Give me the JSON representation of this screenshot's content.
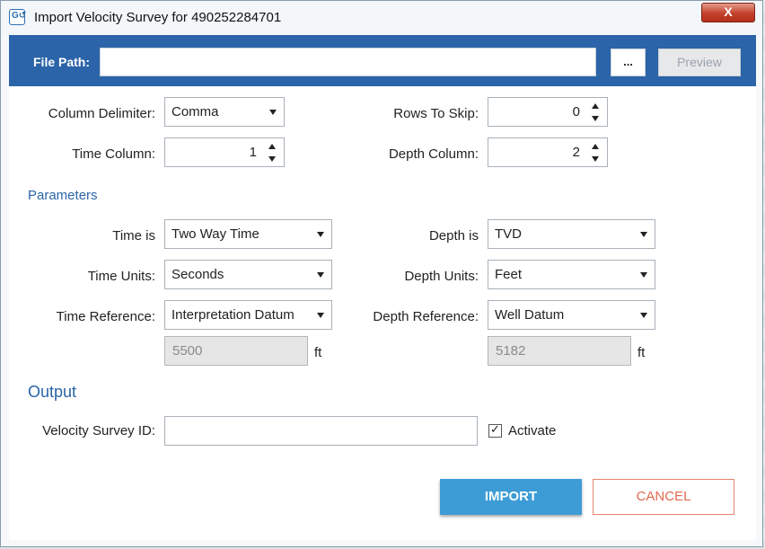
{
  "window": {
    "title": "Import Velocity Survey for 490252284701",
    "close_label": "X"
  },
  "file": {
    "label": "File Path:",
    "value": "",
    "browse_label": "...",
    "preview_label": "Preview"
  },
  "delimiter": {
    "label": "Column Delimiter:",
    "value": "Comma"
  },
  "rows_skip": {
    "label": "Rows To Skip:",
    "value": "0"
  },
  "time_column": {
    "label": "Time Column:",
    "value": "1"
  },
  "depth_column": {
    "label": "Depth Column:",
    "value": "2"
  },
  "parameters": {
    "heading": "Parameters",
    "time_is": {
      "label": "Time is",
      "value": "Two Way Time"
    },
    "depth_is": {
      "label": "Depth is",
      "value": "TVD"
    },
    "time_units": {
      "label": "Time Units:",
      "value": "Seconds"
    },
    "depth_units": {
      "label": "Depth Units:",
      "value": "Feet"
    },
    "time_reference": {
      "label": "Time Reference:",
      "value": "Interpretation Datum",
      "datum_value": "5500",
      "unit": "ft"
    },
    "depth_reference": {
      "label": "Depth Reference:",
      "value": "Well Datum",
      "datum_value": "5182",
      "unit": "ft"
    }
  },
  "output": {
    "heading": "Output",
    "survey_id_label": "Velocity Survey ID:",
    "survey_id_value": "",
    "activate_label": "Activate",
    "activate_checked": true
  },
  "buttons": {
    "import": "IMPORT",
    "cancel": "CANCEL"
  },
  "colors": {
    "accent": "#2b64a8",
    "import_bg": "#3d9cd6",
    "cancel_fg": "#e06a50",
    "close_bg": "#c3412b"
  },
  "icons": {
    "app": "velocity-survey-app-icon",
    "close": "close-icon",
    "dropdown": "chevron-down-icon",
    "spinner": "spinner-arrows-icon",
    "check": "checkmark-icon"
  }
}
